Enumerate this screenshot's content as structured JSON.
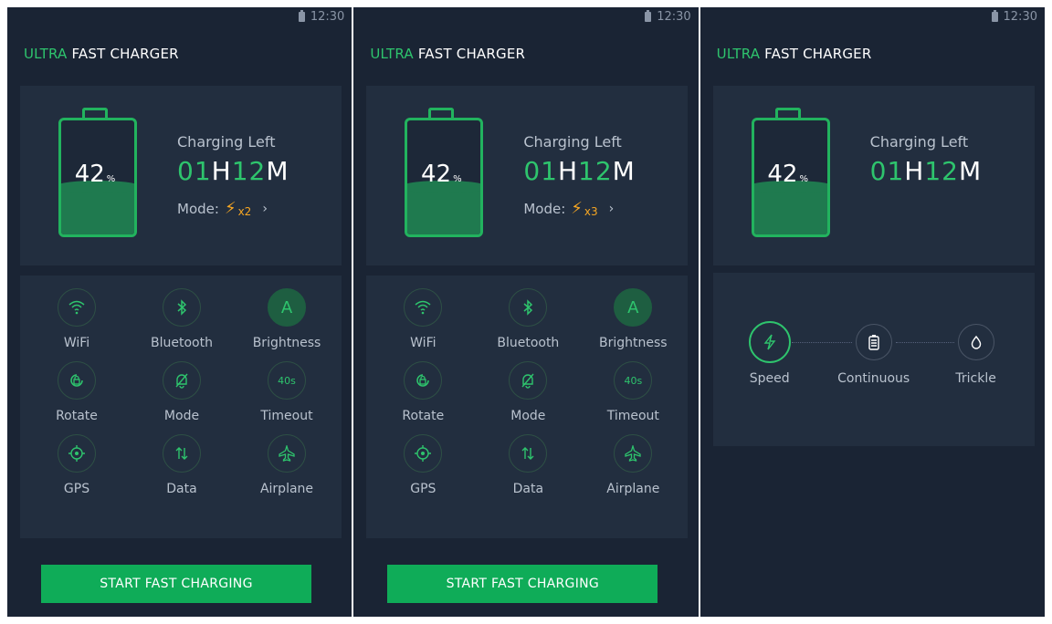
{
  "screens": [
    {
      "status_time": "12:30",
      "title_accent": "ULTRA",
      "title_rest": "FAST CHARGER",
      "battery_percent": "42",
      "battery_unit": "%",
      "battery_level": 0.42,
      "charging_label": "Charging Left",
      "time_hours": "01",
      "time_h": "H",
      "time_minutes": "12",
      "time_m": "M",
      "mode_label": "Mode:",
      "mode_multiplier": "x2",
      "controls": [
        {
          "label": "WiFi",
          "icon": "wifi-icon"
        },
        {
          "label": "Bluetooth",
          "icon": "bluetooth-icon"
        },
        {
          "label": "Brightness",
          "icon": "brightness-icon",
          "glyph": "A"
        },
        {
          "label": "Rotate",
          "icon": "rotate-icon"
        },
        {
          "label": "Mode",
          "icon": "bell-off-icon"
        },
        {
          "label": "Timeout",
          "icon": "timeout-icon",
          "glyph": "40s"
        },
        {
          "label": "GPS",
          "icon": "gps-icon"
        },
        {
          "label": "Data",
          "icon": "data-icon"
        },
        {
          "label": "Airplane",
          "icon": "airplane-icon"
        }
      ],
      "start_button": "START FAST CHARGING"
    },
    {
      "status_time": "12:30",
      "title_accent": "ULTRA",
      "title_rest": "FAST CHARGER",
      "battery_percent": "42",
      "battery_unit": "%",
      "battery_level": 0.42,
      "charging_label": "Charging Left",
      "time_hours": "01",
      "time_h": "H",
      "time_minutes": "12",
      "time_m": "M",
      "mode_label": "Mode:",
      "mode_multiplier": "x3",
      "controls": [
        {
          "label": "WiFi",
          "icon": "wifi-icon"
        },
        {
          "label": "Bluetooth",
          "icon": "bluetooth-icon"
        },
        {
          "label": "Brightness",
          "icon": "brightness-icon",
          "glyph": "A"
        },
        {
          "label": "Rotate",
          "icon": "rotate-icon"
        },
        {
          "label": "Mode",
          "icon": "bell-off-icon"
        },
        {
          "label": "Timeout",
          "icon": "timeout-icon",
          "glyph": "40s"
        },
        {
          "label": "GPS",
          "icon": "gps-icon"
        },
        {
          "label": "Data",
          "icon": "data-icon"
        },
        {
          "label": "Airplane",
          "icon": "airplane-icon"
        }
      ],
      "start_button": "START FAST CHARGING"
    },
    {
      "status_time": "12:30",
      "title_accent": "ULTRA",
      "title_rest": "FAST CHARGER",
      "battery_percent": "42",
      "battery_unit": "%",
      "battery_level": 0.42,
      "charging_label": "Charging Left",
      "time_hours": "01",
      "time_h": "H",
      "time_minutes": "12",
      "time_m": "M",
      "steps": [
        {
          "label": "Speed",
          "icon": "lightning-icon",
          "active": true
        },
        {
          "label": "Continuous",
          "icon": "battery-icon",
          "active": false
        },
        {
          "label": "Trickle",
          "icon": "droplet-icon",
          "active": false
        }
      ]
    }
  ],
  "colors": {
    "background": "#1a2434",
    "panel": "#222e3f",
    "accent_green": "#2ec46d",
    "button_green": "#0fac58",
    "bolt_orange": "#f6a623"
  }
}
